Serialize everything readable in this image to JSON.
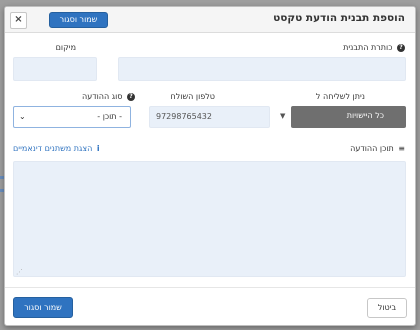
{
  "modal": {
    "title": "הוספת תבנית הודעת טקסט",
    "save_close_label": "שמור וסגור",
    "close_symbol": "×"
  },
  "form": {
    "template_title_label": "כותרת התבנית",
    "template_title_value": "",
    "location_label": "מיקום",
    "location_value": "",
    "send_to_label": "ניתן לשליחה ל",
    "send_to_value": "כל היישויות",
    "sender_phone_label": "טלפון השולח",
    "sender_phone_value": "97298765432",
    "message_type_label": "סוג ההודעה",
    "message_type_value": "- תוכן -",
    "message_content_label": "תוכן ההודעה",
    "dynamic_vars_link": "הצגת משתנים דינאמיים",
    "message_content_value": ""
  },
  "footer": {
    "cancel_label": "ביטול",
    "save_close_label": "שמור וסגור"
  },
  "colors": {
    "primary_button": "#2f73c0",
    "field_background": "#e9f0f9",
    "dark_select": "#6f6f6f"
  }
}
